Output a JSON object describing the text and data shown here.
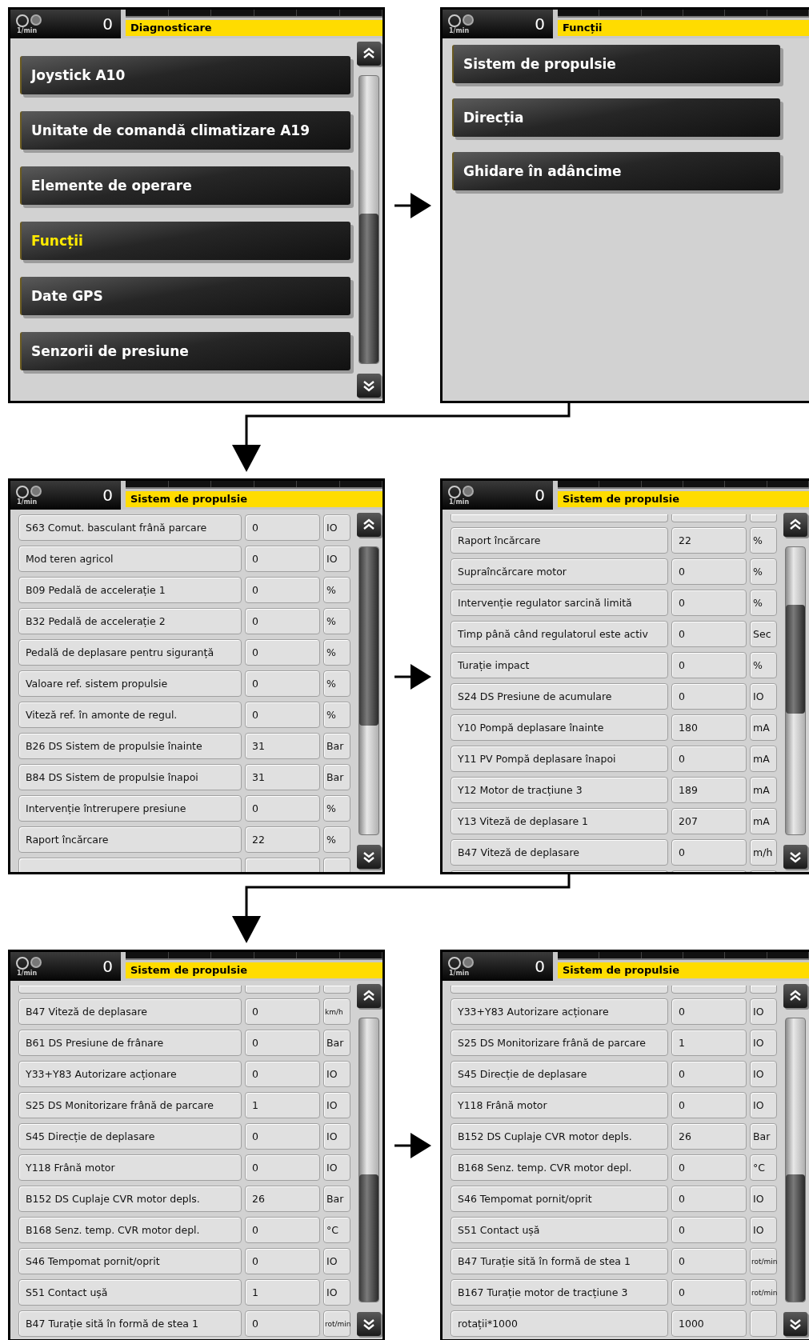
{
  "screens": [
    {
      "kind": "menu",
      "header": {
        "unit": "1/min",
        "value": "0",
        "title": "Diagnosticare"
      },
      "scrollbar": true,
      "items": [
        {
          "label": "Joystick A10",
          "selected": false
        },
        {
          "label": "Unitate de comandă climatizare A19",
          "selected": false
        },
        {
          "label": "Elemente de operare",
          "selected": false
        },
        {
          "label": "Funcții",
          "selected": true
        },
        {
          "label": "Date GPS",
          "selected": false
        },
        {
          "label": "Senzorii de presiune",
          "selected": false
        }
      ]
    },
    {
      "kind": "menu",
      "header": {
        "unit": "1/min",
        "value": "0",
        "title": "Funcții"
      },
      "items": [
        {
          "label": "Sistem de propulsie",
          "selected": false
        },
        {
          "label": "Direcția",
          "selected": false
        },
        {
          "label": "Ghidare în adâncime",
          "selected": false
        }
      ]
    },
    {
      "kind": "table",
      "header": {
        "unit": "1/min",
        "value": "0",
        "title": "Sistem de propulsie"
      },
      "scrollbar": true,
      "cut_row_above": false,
      "cut_row_below": true,
      "rows": [
        {
          "label": "S63 Comut. basculant frână parcare",
          "value": "0",
          "unit": "IO"
        },
        {
          "label": "Mod teren agricol",
          "value": "0",
          "unit": "IO"
        },
        {
          "label": "B09 Pedală de accelerație 1",
          "value": "0",
          "unit": "%"
        },
        {
          "label": "B32 Pedală de accelerație 2",
          "value": "0",
          "unit": "%"
        },
        {
          "label": "Pedală de deplasare pentru siguranță",
          "value": "0",
          "unit": "%"
        },
        {
          "label": "Valoare ref. sistem propulsie",
          "value": "0",
          "unit": "%"
        },
        {
          "label": "Viteză ref. în amonte de regul.",
          "value": "0",
          "unit": "%"
        },
        {
          "label": "B26 DS Sistem de propulsie înainte",
          "value": "31",
          "unit": "Bar"
        },
        {
          "label": "B84 DS Sistem de propulsie înapoi",
          "value": "31",
          "unit": "Bar"
        },
        {
          "label": "Intervenție întrerupere presiune",
          "value": "0",
          "unit": "%"
        },
        {
          "label": "Raport încărcare",
          "value": "22",
          "unit": "%"
        }
      ]
    },
    {
      "kind": "table",
      "header": {
        "unit": "1/min",
        "value": "0",
        "title": "Sistem de propulsie"
      },
      "scrollbar": true,
      "cut_row_above": true,
      "cut_row_below": true,
      "rows": [
        {
          "label": "Raport încărcare",
          "value": "22",
          "unit": "%"
        },
        {
          "label": "Supraîncărcare motor",
          "value": "0",
          "unit": "%"
        },
        {
          "label": "Intervenție regulator sarcină limită",
          "value": "0",
          "unit": "%"
        },
        {
          "label": "Timp până când regulatorul este activ",
          "value": "0",
          "unit": "Sec"
        },
        {
          "label": "Turație impact",
          "value": "0",
          "unit": "%"
        },
        {
          "label": "S24 DS Presiune de acumulare",
          "value": "0",
          "unit": "IO"
        },
        {
          "label": "Y10 Pompă deplasare înainte",
          "value": "180",
          "unit": "mA"
        },
        {
          "label": "Y11 PV Pompă deplasare înapoi",
          "value": "0",
          "unit": "mA"
        },
        {
          "label": "Y12 Motor de tracțiune 3",
          "value": "189",
          "unit": "mA"
        },
        {
          "label": "Y13 Viteză de deplasare 1",
          "value": "207",
          "unit": "mA"
        },
        {
          "label": "B47 Viteză de deplasare",
          "value": "0",
          "unit": "m/h"
        }
      ]
    },
    {
      "kind": "table",
      "header": {
        "unit": "1/min",
        "value": "0",
        "title": "Sistem de propulsie"
      },
      "scrollbar": true,
      "cut_row_above": true,
      "cut_row_below": false,
      "rows": [
        {
          "label": "B47 Viteză de deplasare",
          "value": "0",
          "unit": "km/h"
        },
        {
          "label": "B61 DS Presiune de frânare",
          "value": "0",
          "unit": "Bar"
        },
        {
          "label": "Y33+Y83 Autorizare acționare",
          "value": "0",
          "unit": "IO"
        },
        {
          "label": "S25 DS Monitorizare frână de parcare",
          "value": "1",
          "unit": "IO"
        },
        {
          "label": "S45 Direcție de deplasare",
          "value": "0",
          "unit": "IO"
        },
        {
          "label": "Y118 Frână motor",
          "value": "0",
          "unit": "IO"
        },
        {
          "label": "B152 DS Cuplaje CVR motor depls.",
          "value": "26",
          "unit": "Bar"
        },
        {
          "label": "B168 Senz. temp. CVR motor depl.",
          "value": "0",
          "unit": "°C"
        },
        {
          "label": "S46 Tempomat pornit/oprit",
          "value": "0",
          "unit": "IO"
        },
        {
          "label": "S51 Contact ușă",
          "value": "1",
          "unit": "IO"
        },
        {
          "label": "B47 Turație sită în formă de stea 1",
          "value": "0",
          "unit": "rot/min"
        }
      ]
    },
    {
      "kind": "table",
      "header": {
        "unit": "1/min",
        "value": "0",
        "title": "Sistem de propulsie"
      },
      "scrollbar": true,
      "cut_row_above": true,
      "cut_row_below": false,
      "rows": [
        {
          "label": "Y33+Y83 Autorizare acționare",
          "value": "0",
          "unit": "IO"
        },
        {
          "label": "S25 DS Monitorizare frână de parcare",
          "value": "1",
          "unit": "IO"
        },
        {
          "label": "S45 Direcție de deplasare",
          "value": "0",
          "unit": "IO"
        },
        {
          "label": "Y118 Frână motor",
          "value": "0",
          "unit": "IO"
        },
        {
          "label": "B152 DS Cuplaje CVR motor depls.",
          "value": "26",
          "unit": "Bar"
        },
        {
          "label": "B168 Senz. temp. CVR motor depl.",
          "value": "0",
          "unit": "°C"
        },
        {
          "label": "S46 Tempomat pornit/oprit",
          "value": "0",
          "unit": "IO"
        },
        {
          "label": "S51 Contact ușă",
          "value": "0",
          "unit": "IO"
        },
        {
          "label": "B47 Turație sită în formă de stea 1",
          "value": "0",
          "unit": "rot/min"
        },
        {
          "label": "B167 Turație motor de tracțiune 3",
          "value": "0",
          "unit": "rot/min"
        },
        {
          "label": "rotații*1000",
          "value": "1000"
        }
      ]
    }
  ]
}
